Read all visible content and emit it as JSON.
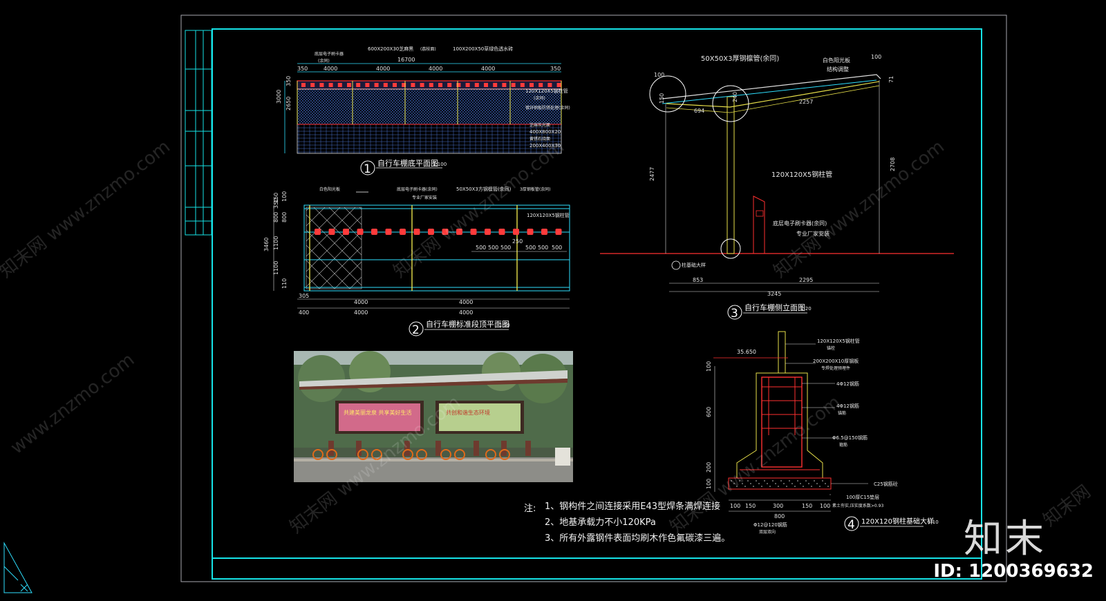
{
  "drawing": {
    "plan1": {
      "title": "自行车棚底平面图",
      "scale": "1:100",
      "number": "1",
      "top_labels": [
        "底层电子刷卡器",
        "(余同)",
        "600X200X30芝麻黑",
        "(荔枝面)",
        "100X200X50草绿色透水砖"
      ],
      "overall_dim": "16700",
      "segments": [
        "350",
        "4000",
        "4000",
        "4000",
        "4000",
        "350"
      ],
      "side_dims": [
        "3000",
        "2650",
        "350"
      ],
      "right_labels": [
        "120X120X5钢柱管",
        "(余同)",
        "镀锌钢板防锈处理(余同)",
        "芝麻灰光面",
        "400X800X20",
        "黄锈石烧面",
        "200X400X30"
      ]
    },
    "plan2": {
      "title": "自行车棚标准段顶平面图",
      "scale": "1:50",
      "number": "2",
      "top_labels": [
        "白色阳光板",
        "底层电子刷卡器(余同)",
        "专业厂家安装",
        "50X50X3方钢檩管(余同)",
        "3厚钢板管(余同)"
      ],
      "label_120": "120X120X5钢柱管",
      "left_dims": [
        "3460",
        "350",
        "800",
        "1100",
        "1100",
        "800",
        "110",
        "100",
        "150"
      ],
      "bottom_dims": [
        "305",
        "4000",
        "4000"
      ],
      "bottom_dims2": [
        "400",
        "4000",
        "4000"
      ],
      "mid_dims": [
        "500",
        "500",
        "500",
        "250",
        "500",
        "500",
        "500"
      ]
    },
    "elev3": {
      "title": "自行车棚侧立面图",
      "scale": "1:20",
      "number": "3",
      "labels": [
        "50X50X3厚钢檩管(余同)",
        "白色阳光板",
        "结构调整",
        "120X120X5钢柱管",
        "底层电子刷卡器(余同)",
        "专业厂家安装",
        "柱基础大样"
      ],
      "dims": [
        "100",
        "150",
        "694",
        "240",
        "2257",
        "2477",
        "2708",
        "853",
        "2295",
        "3245",
        "100",
        "71"
      ]
    },
    "detail4": {
      "title": "120X120钢柱基础大样",
      "scale": "1:10",
      "number": "4",
      "elev": "35.650",
      "labels": [
        "120X120X5钢柱管",
        "锚栓",
        "200X200X10厚钢板",
        "专焊处理预埋件",
        "4Φ12钢筋",
        "4Φ12钢筋",
        "锚筋",
        "Φ6.5@150钢筋",
        "箍筋",
        "C25钢筋砼",
        "100厚C15垫层",
        "素土夯实,压实度系数>0.93",
        "Φ12@120钢筋",
        "双层双向"
      ],
      "left_dims": [
        "100",
        "600",
        "200",
        "100"
      ],
      "bottom_dims": [
        "100",
        "150",
        "300",
        "150",
        "100"
      ],
      "bottom_total": "800"
    }
  },
  "notes": {
    "prefix": "注:",
    "items": [
      "1、钢构件之间连接采用E43型焊条满焊连接",
      "2、地基承载力不小120KPa",
      "3、所有外露钢件表面均刷木作色氟碳漆三遍。"
    ]
  },
  "photo": {
    "board_left": "共建美丽龙泉 共享美好生活",
    "board_right": "共创和谐生态环境"
  },
  "watermark": {
    "site": "www.znzmo.com",
    "cn": "知末网",
    "brand": "知末",
    "id": "ID: 1200369632"
  },
  "colors": {
    "frame": "#16e4e8",
    "cyan": "#2fe0ff",
    "yellow": "#e8e04a",
    "red": "#ff3030",
    "white": "#ffffff",
    "bg": "#000000"
  }
}
